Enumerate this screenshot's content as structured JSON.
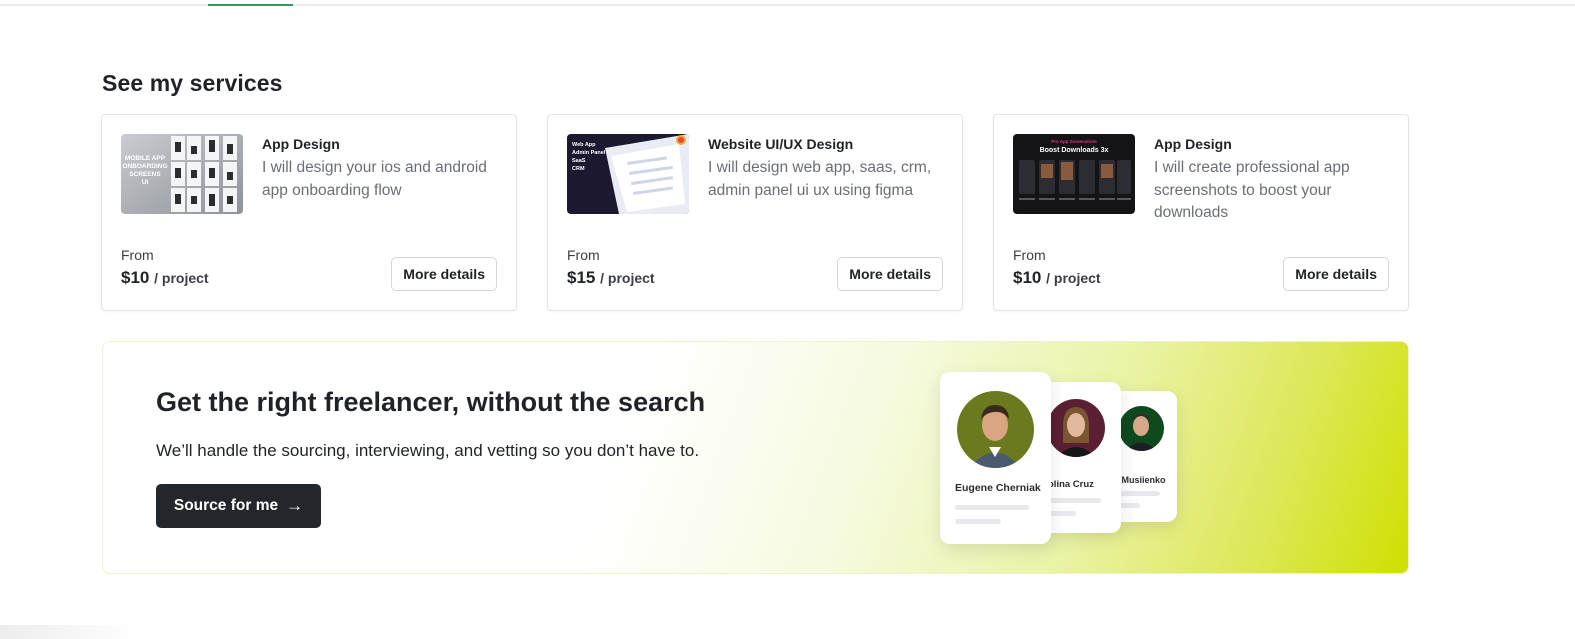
{
  "page": {
    "section_title": "See my services"
  },
  "services": [
    {
      "category": "App Design",
      "description": "I will design your ios and android app onboarding flow",
      "from_label": "From",
      "price": "$10",
      "price_unit": "/ project",
      "button_label": "More details",
      "thumbnail_text": [
        "MOBILE APP",
        "ONBOARDING",
        "SCREENS",
        "UI"
      ]
    },
    {
      "category": "Website UI/UX Design",
      "description": "I will design web app, saas, crm, admin panel ui ux using figma",
      "from_label": "From",
      "price": "$15",
      "price_unit": "/ project",
      "button_label": "More details",
      "thumbnail_text": [
        "Web App",
        "Admin Panel",
        "SaaS",
        "CRM"
      ]
    },
    {
      "category": "App Design",
      "description": "I will create professional app screenshots to boost your downloads",
      "from_label": "From",
      "price": "$10",
      "price_unit": "/ project",
      "button_label": "More details",
      "thumbnail_text": [
        "Pro App Screenshots",
        "Boost Downloads 3x"
      ]
    }
  ],
  "banner": {
    "title": "Get the right freelancer, without the search",
    "subtitle": "We’ll handle the sourcing, interviewing, and vetting so you don’t have to.",
    "button_label": "Source for me",
    "button_icon": "arrow-right-icon",
    "profiles": [
      {
        "name": "Eugene Cherniak",
        "avatar_bg": "#6b7a1f"
      },
      {
        "name": "olina Cruz",
        "avatar_bg": "#5a1f33"
      },
      {
        "name": "or Musiienko",
        "avatar_bg": "#0f4a1f"
      }
    ]
  },
  "colors": {
    "accent_tab": "#2e9a63",
    "dark_button": "#23262a",
    "banner_gradient_end": "#cfe000"
  }
}
